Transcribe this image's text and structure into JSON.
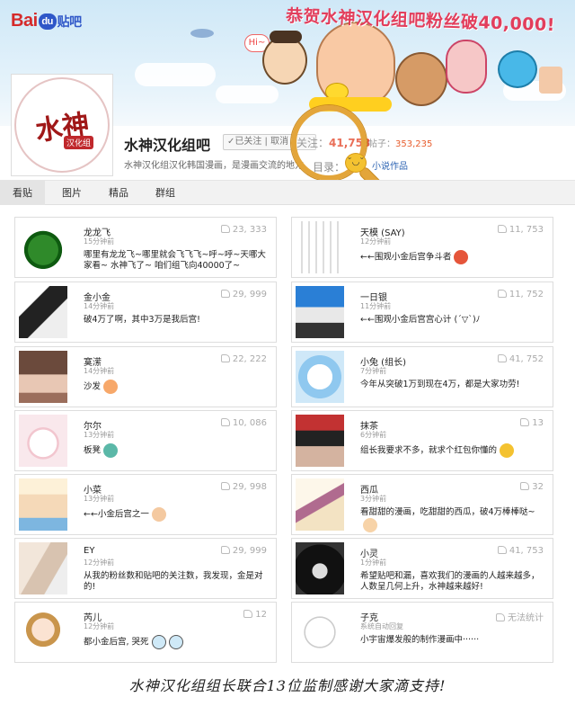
{
  "site": {
    "logo_text": "Bai",
    "logo_paw": "du",
    "logo_tieba": "贴吧"
  },
  "banner": {
    "headline": "恭贺水神汉化组吧粉丝破40,000!",
    "bubble": "Hi~"
  },
  "forum": {
    "avatar_seal": "水神",
    "avatar_sub": "汉化组",
    "name": "水神汉化组吧",
    "follow_label": "✓已关注 | 取消",
    "members_label": "关注：",
    "members_count": "41,753",
    "posts_label": "帖子：",
    "posts_count": "353,235",
    "description": "水神汉化组汉化韩国漫画，是漫画交流的地方",
    "catalog_label": "目录：",
    "catalog_link": "小说作品"
  },
  "tabs": [
    "看贴",
    "图片",
    "精品",
    "群组"
  ],
  "posts_left": [
    {
      "name": "龙龙飞",
      "time": "15分钟前",
      "likes": "23, 333",
      "text": "哪里有龙龙飞~哪里就会飞飞飞~呼~呼~天哪大家看~ 水神飞了~ 咱们组飞向40000了~"
    },
    {
      "name": "金小金",
      "time": "14分钟前",
      "likes": "29, 999",
      "text": "破4万了啊，其中3万是我后宫!"
    },
    {
      "name": "寞潆",
      "time": "14分钟前",
      "likes": "22, 222",
      "text": "沙发"
    },
    {
      "name": "尔尔",
      "time": "13分钟前",
      "likes": "10, 086",
      "text": "板凳"
    },
    {
      "name": "小菜",
      "time": "13分钟前",
      "likes": "29, 998",
      "text": "←←小金后宫之一"
    },
    {
      "name": "EY",
      "time": "12分钟前",
      "likes": "29, 999",
      "text": "从我的粉丝数和贴吧的关注数，我发现，金是对的!"
    },
    {
      "name": "芮儿",
      "time": "12分钟前",
      "likes": "12",
      "text": "都小金后宫, 哭死"
    }
  ],
  "posts_right": [
    {
      "name": "天模 (SAY)",
      "time": "12分钟前",
      "likes": "11, 753",
      "text": "←←围观小金后宫争斗者"
    },
    {
      "name": "一日银",
      "time": "11分钟前",
      "likes": "11, 752",
      "text": "←←围观小金后宫宫心计 (´▽`)ﾉ"
    },
    {
      "name": "小兔 (组长)",
      "time": "7分钟前",
      "likes": "41, 752",
      "text": "今年从突破1万到现在4万，都是大家功劳!"
    },
    {
      "name": "抹茶",
      "time": "6分钟前",
      "likes": "13",
      "text": "组长我要求不多，就求个红包你懂的"
    },
    {
      "name": "西瓜",
      "time": "3分钟前",
      "likes": "32",
      "text": "看甜甜的漫画，吃甜甜的西瓜，破4万棒棒哒~"
    },
    {
      "name": "小灵",
      "time": "1分钟前",
      "likes": "41, 753",
      "text": "希望贴吧和漏，喜欢我们的漫画的人越来越多，人数呈几何上升，水神越来越好!"
    },
    {
      "name": "子克",
      "time": "系统自动回复",
      "likes": "无法统计",
      "text": "小宇宙爆发般的制作漫画中······"
    }
  ],
  "footer": {
    "caption": "水神汉化组组长联合13位监制感谢大家滴支持!"
  },
  "colors": {
    "accent_red": "#e23e5c",
    "link_blue": "#2d64b3",
    "member_count": "#e6553a"
  }
}
